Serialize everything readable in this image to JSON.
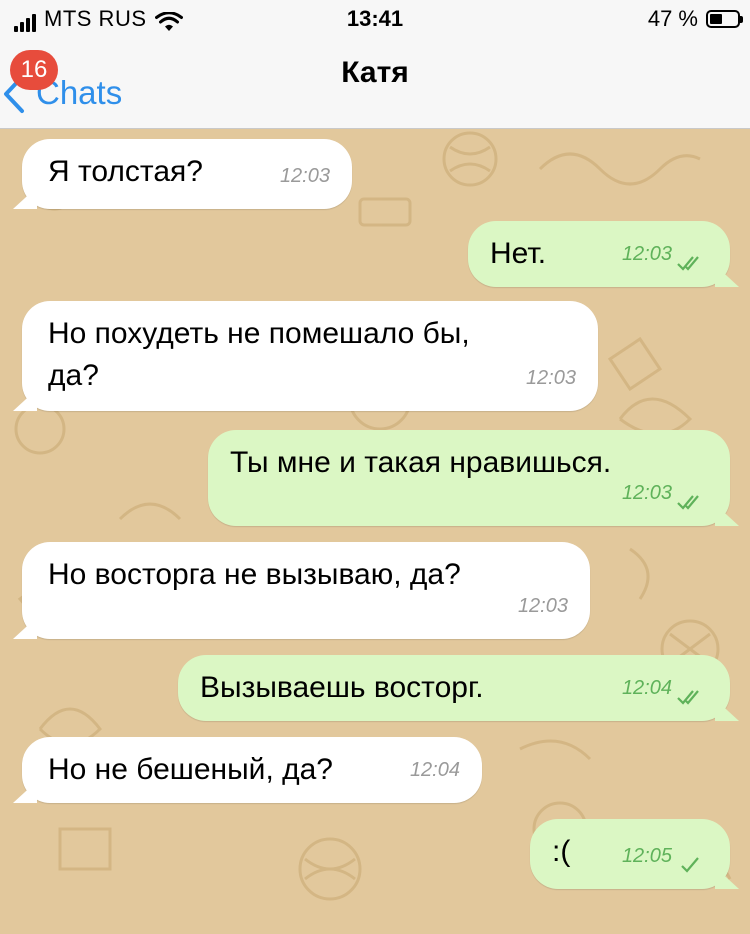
{
  "status_bar": {
    "carrier": "MTS RUS",
    "time": "13:41",
    "battery_text": "47 %",
    "battery_level": 0.47
  },
  "nav": {
    "back_label": "Chats",
    "unread_badge": "16",
    "contact_name": "Катя"
  },
  "colors": {
    "accent": "#2f8fea",
    "badge": "#e74c3c",
    "wallpaper": "#e2c89c",
    "incoming_bubble": "#ffffff",
    "outgoing_bubble": "#dbf7c4",
    "checkmark": "#5fb25a"
  },
  "messages": [
    {
      "direction": "in",
      "text": "Я толстая?",
      "time": "12:03"
    },
    {
      "direction": "out",
      "text": "Нет.",
      "time": "12:03",
      "status": "read"
    },
    {
      "direction": "in",
      "text": "Но похудеть не помешало бы,\nда?",
      "time": "12:03"
    },
    {
      "direction": "out",
      "text": "Ты мне и такая нравишься.",
      "time": "12:03",
      "status": "read"
    },
    {
      "direction": "in",
      "text": "Но восторга не вызываю, да?",
      "time": "12:03"
    },
    {
      "direction": "out",
      "text": "Вызываешь восторг.",
      "time": "12:04",
      "status": "read"
    },
    {
      "direction": "in",
      "text": "Но не бешеный, да?",
      "time": "12:04"
    },
    {
      "direction": "out",
      "text": ":(",
      "time": "12:05",
      "status": "delivered"
    }
  ]
}
